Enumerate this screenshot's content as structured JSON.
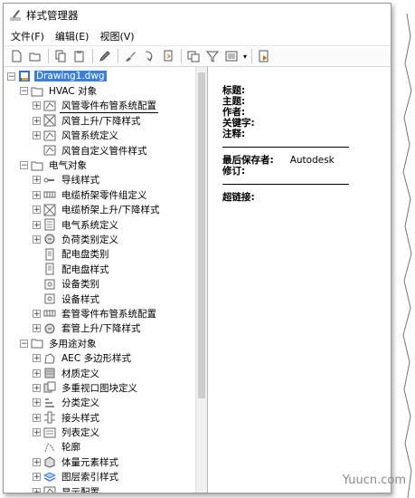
{
  "window": {
    "title": "样式管理器"
  },
  "menu": [
    {
      "label": "文件(F)"
    },
    {
      "label": "编辑(E)"
    },
    {
      "label": "视图(V)"
    }
  ],
  "toolbar": [
    {
      "icon": "new-icon"
    },
    {
      "icon": "open-icon"
    },
    {
      "icon": "copy-icon"
    },
    {
      "icon": "paste-icon"
    },
    {
      "icon": "edit-icon"
    },
    {
      "icon": "brush-icon"
    },
    {
      "icon": "purge-icon"
    },
    {
      "icon": "export-icon"
    },
    {
      "icon": "views-icon"
    },
    {
      "icon": "filter-icon"
    },
    {
      "icon": "list-view-icon"
    },
    {
      "icon": "help-icon"
    }
  ],
  "tree": [
    {
      "level": 0,
      "exp": "-",
      "icon": "drawing",
      "label": "Drawing1.dwg",
      "selected": true
    },
    {
      "level": 1,
      "exp": "-",
      "icon": "folder",
      "label": "HVAC 对象"
    },
    {
      "level": 2,
      "exp": "+",
      "icon": "duct",
      "label": "风管零件布管系统配置",
      "underlined": true
    },
    {
      "level": 2,
      "exp": "+",
      "icon": "box-x",
      "label": "风管上升/下降样式"
    },
    {
      "level": 2,
      "exp": "+",
      "icon": "duct",
      "label": "风管系统定义"
    },
    {
      "level": 2,
      "exp": "",
      "icon": "duct",
      "label": "风管自定义管件样式"
    },
    {
      "level": 1,
      "exp": "-",
      "icon": "folder",
      "label": "电气对象"
    },
    {
      "level": 2,
      "exp": "+",
      "icon": "wire",
      "label": "导线样式"
    },
    {
      "level": 2,
      "exp": "+",
      "icon": "tray",
      "label": "电缆桥架零件组定义"
    },
    {
      "level": 2,
      "exp": "+",
      "icon": "box-x",
      "label": "电缆桥架上升/下降样式"
    },
    {
      "level": 2,
      "exp": "+",
      "icon": "elec",
      "label": "电气系统定义"
    },
    {
      "level": 2,
      "exp": "+",
      "icon": "load",
      "label": "负荷类别定义"
    },
    {
      "level": 2,
      "exp": "",
      "icon": "panel",
      "label": "配电盘类别"
    },
    {
      "level": 2,
      "exp": "",
      "icon": "panel",
      "label": "配电盘样式"
    },
    {
      "level": 2,
      "exp": "",
      "icon": "device",
      "label": "设备类别"
    },
    {
      "level": 2,
      "exp": "",
      "icon": "device",
      "label": "设备样式"
    },
    {
      "level": 2,
      "exp": "+",
      "icon": "tray",
      "label": "套管零件布管系统配置"
    },
    {
      "level": 2,
      "exp": "+",
      "icon": "load",
      "label": "套管上升/下降样式"
    },
    {
      "level": 1,
      "exp": "-",
      "icon": "folder",
      "label": "多用途对象"
    },
    {
      "level": 2,
      "exp": "+",
      "icon": "poly",
      "label": "AEC 多边形样式"
    },
    {
      "level": 2,
      "exp": "+",
      "icon": "material",
      "label": "材质定义"
    },
    {
      "level": 2,
      "exp": "+",
      "icon": "block",
      "label": "多重视口图块定义"
    },
    {
      "level": 2,
      "exp": "+",
      "icon": "class",
      "label": "分类定义"
    },
    {
      "level": 2,
      "exp": "+",
      "icon": "head",
      "label": "接头样式"
    },
    {
      "level": 2,
      "exp": "+",
      "icon": "list",
      "label": "列表定义"
    },
    {
      "level": 2,
      "exp": "",
      "icon": "profile",
      "label": "轮廓"
    },
    {
      "level": 2,
      "exp": "+",
      "icon": "mass",
      "label": "体量元素样式"
    },
    {
      "level": 2,
      "exp": "+",
      "icon": "layer",
      "label": "图层索引样式"
    },
    {
      "level": 2,
      "exp": "+",
      "icon": "duct",
      "label": "显示配置"
    }
  ],
  "details": {
    "fields": [
      {
        "label": "标题:",
        "value": ""
      },
      {
        "label": "主题:",
        "value": ""
      },
      {
        "label": "作者:",
        "value": ""
      },
      {
        "label": "关键字:",
        "value": ""
      },
      {
        "label": "注释:",
        "value": ""
      }
    ],
    "saved_by_label": "最后保存者:",
    "saved_by_value": "Autodesk",
    "revision_label": "修订:",
    "hyperlink_label": "超链接:"
  },
  "watermark": "Yuucn.com"
}
